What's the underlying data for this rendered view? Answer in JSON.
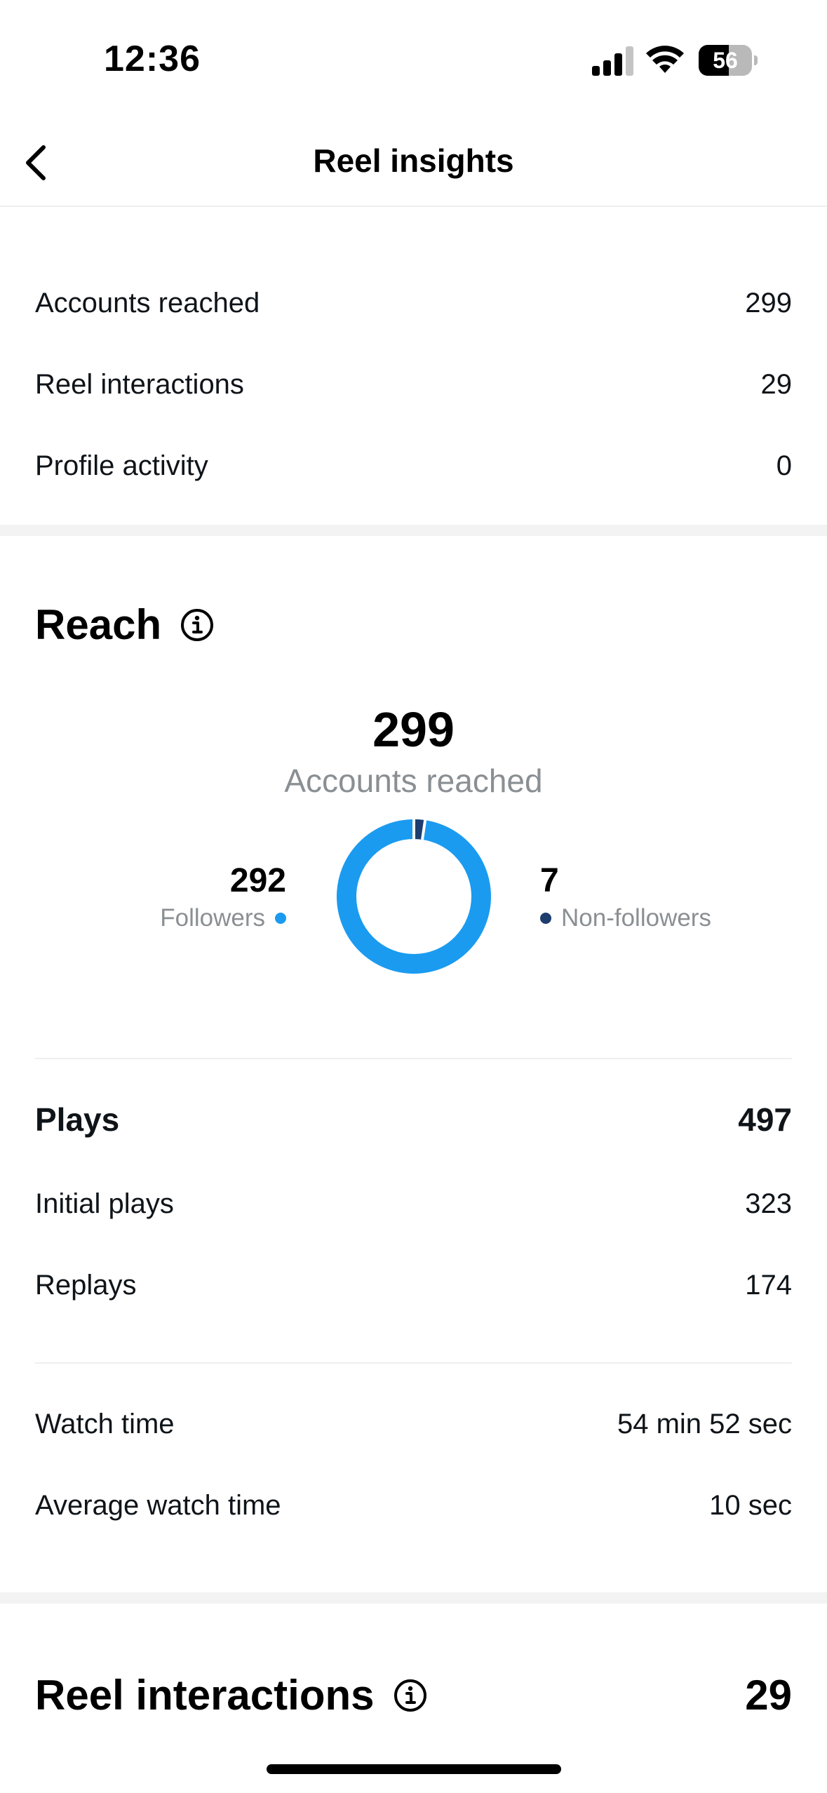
{
  "status_bar": {
    "time": "12:36",
    "battery": "56",
    "battery_level": 0.56,
    "icons": [
      "signal-icon",
      "wifi-icon",
      "battery-icon"
    ]
  },
  "nav": {
    "title": "Reel insights",
    "back_icon": "chevron-left-icon"
  },
  "overview": [
    {
      "label": "Accounts reached",
      "value": "299"
    },
    {
      "label": "Reel interactions",
      "value": "29"
    },
    {
      "label": "Profile activity",
      "value": "0"
    }
  ],
  "reach": {
    "title": "Reach",
    "info_icon": "info-icon",
    "total": "299",
    "total_label": "Accounts reached",
    "followers": {
      "value": "292",
      "label": "Followers",
      "color": "#1a9bf0"
    },
    "non_followers": {
      "value": "7",
      "label": "Non-followers",
      "color": "#1c3d6e"
    }
  },
  "plays": {
    "title": "Plays",
    "total": "497",
    "rows": [
      {
        "label": "Initial plays",
        "value": "323"
      },
      {
        "label": "Replays",
        "value": "174"
      }
    ]
  },
  "watch": {
    "rows": [
      {
        "label": "Watch time",
        "value": "54 min 52 sec"
      },
      {
        "label": "Average watch time",
        "value": "10 sec"
      }
    ]
  },
  "interactions": {
    "title": "Reel interactions",
    "info_icon": "info-icon",
    "total": "29"
  },
  "colors": {
    "followers": "#1a9bf0",
    "non_followers": "#1c3d6e",
    "muted_text": "#8a8f93"
  }
}
